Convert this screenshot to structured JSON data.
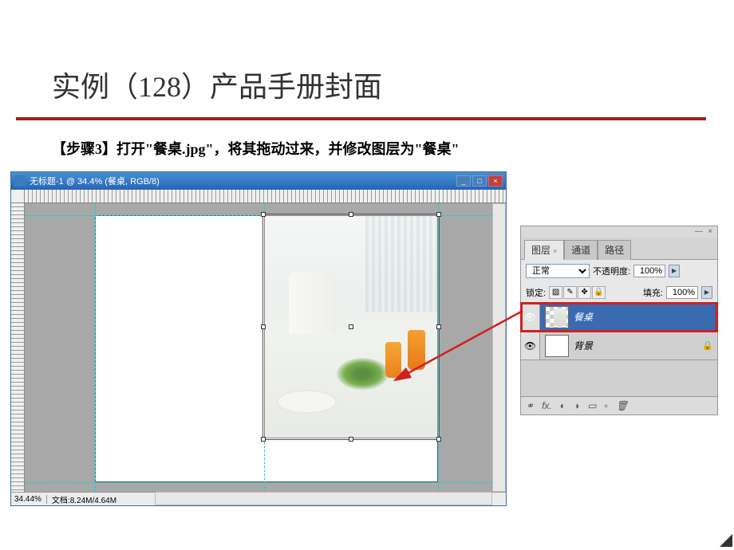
{
  "slide": {
    "title": "实例（128）产品手册封面",
    "instruction": "【步骤3】打开\"餐桌.jpg\"，将其拖动过来，并修改图层为\"餐桌\""
  },
  "ps_window": {
    "title": "无标题-1 @ 34.4% (餐桌, RGB/8)",
    "zoom": "34.44%",
    "docinfo": "文档:8.24M/4.64M"
  },
  "layers_panel": {
    "tabs": {
      "layers": "图层",
      "channels": "通道",
      "paths": "路径"
    },
    "blend_mode": "正常",
    "opacity_label": "不透明度:",
    "opacity_value": "100%",
    "lock_label": "锁定:",
    "fill_label": "填充:",
    "fill_value": "100%",
    "layers": [
      {
        "name": "餐桌",
        "selected": true,
        "thumb": "checker"
      },
      {
        "name": "背景",
        "selected": false,
        "thumb": "white",
        "locked": true
      }
    ],
    "footer_icons": {
      "link": "⚭",
      "fx": "fx.",
      "mask": "◐",
      "adjust": "◑",
      "folder": "▭",
      "new": "▫",
      "trash": "🗑"
    }
  }
}
